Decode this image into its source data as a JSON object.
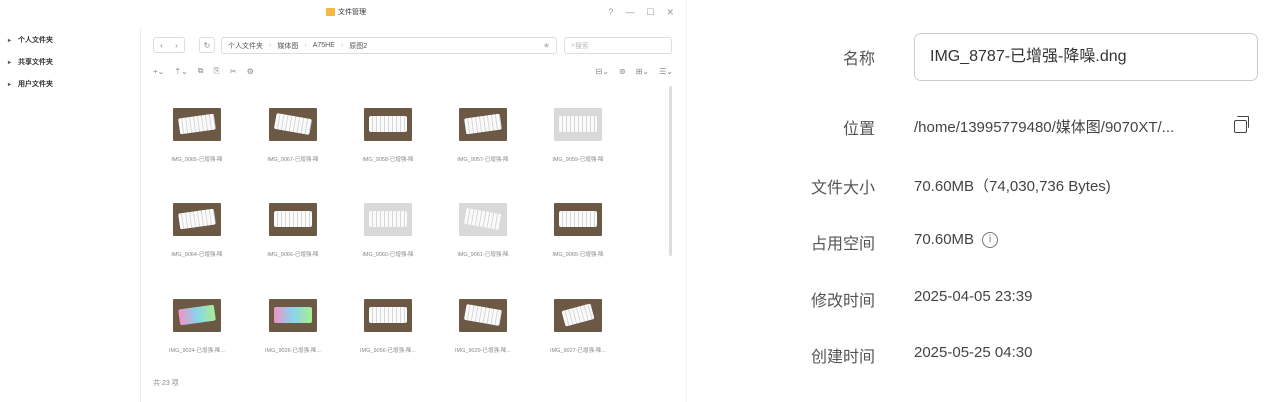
{
  "window": {
    "title": "文件管理",
    "help_icon": "?"
  },
  "sidebar": {
    "items": [
      {
        "label": "个人文件夹"
      },
      {
        "label": "共享文件夹"
      },
      {
        "label": "用户文件夹"
      }
    ]
  },
  "nav": {
    "breadcrumb": [
      "个人文件夹",
      "媒体图",
      "A75HE",
      "原图2"
    ],
    "search_placeholder": "搜索"
  },
  "files": [
    {
      "name": "IMG_9065-已增强-降",
      "tone": "dark",
      "kb": "a"
    },
    {
      "name": "IMG_9067-已增强-降",
      "tone": "dark",
      "kb": "b"
    },
    {
      "name": "IMG_9058-已增强-降",
      "tone": "dark",
      "kb": "c"
    },
    {
      "name": "IMG_9057-已增强-降",
      "tone": "dark",
      "kb": "a"
    },
    {
      "name": "IMG_9059-已增强-降",
      "tone": "light",
      "kb": "c"
    },
    {
      "name": "IMG_9064-已增强-降",
      "tone": "dark",
      "kb": "a"
    },
    {
      "name": "IMG_9066-已增强-降",
      "tone": "dark",
      "kb": "c"
    },
    {
      "name": "IMG_9060-已增强-降",
      "tone": "light",
      "kb": "c"
    },
    {
      "name": "IMG_9061-已增强-降",
      "tone": "light",
      "kb": "b"
    },
    {
      "name": "IMG_9065-已增强-降",
      "tone": "dark",
      "kb": "c"
    },
    {
      "name": "IMG_9024-已增强-降...",
      "tone": "rgb",
      "kb": "a"
    },
    {
      "name": "IMG_9026-已增强-降...",
      "tone": "rgb",
      "kb": "c"
    },
    {
      "name": "IMG_9056-已增强-降...",
      "tone": "dark",
      "kb": "c"
    },
    {
      "name": "IMG_9029-已增强-降...",
      "tone": "dark",
      "kb": "b"
    },
    {
      "name": "IMG_9027-已增强-降...",
      "tone": "dark",
      "kb": "d"
    }
  ],
  "status": {
    "count": "共 23 项"
  },
  "details": {
    "name_label": "名称",
    "name_value": "IMG_8787-已增强-降噪.dng",
    "location_label": "位置",
    "location_value": "/home/13995779480/媒体图/9070XT/...",
    "size_label": "文件大小",
    "size_value": "70.60MB（74,030,736 Bytes)",
    "used_label": "占用空间",
    "used_value": "70.60MB",
    "modified_label": "修改时间",
    "modified_value": "2025-04-05 23:39",
    "created_label": "创建时间",
    "created_value": "2025-05-25 04:30"
  }
}
